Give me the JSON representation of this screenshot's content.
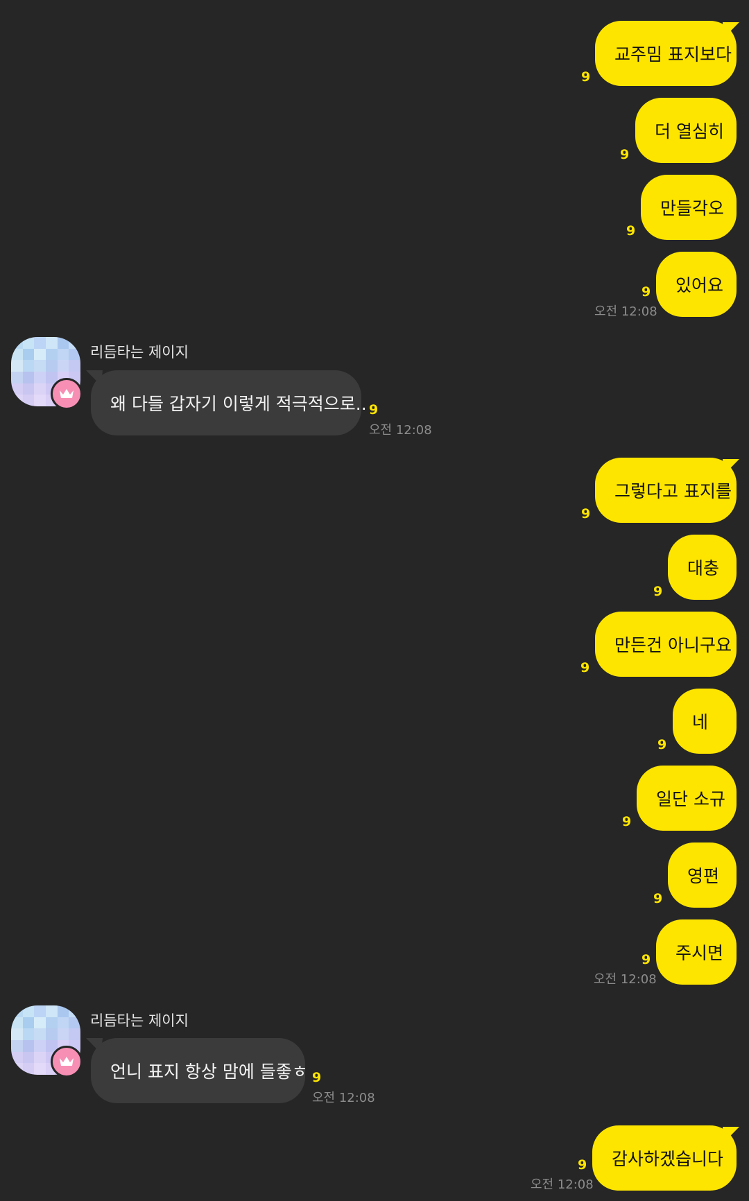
{
  "contact": {
    "name": "리듬타는 제이지"
  },
  "messages": [
    {
      "from": "me",
      "text": "교주밈 표지보다",
      "unread": "9"
    },
    {
      "from": "me",
      "text": "더 열심히",
      "unread": "9"
    },
    {
      "from": "me",
      "text": "만들각오",
      "unread": "9"
    },
    {
      "from": "me",
      "text": "있어요",
      "unread": "9",
      "time": "오전 12:08"
    },
    {
      "from": "other",
      "sender": "리듬타는 제이지",
      "text": "왜 다들 갑자기 이렇게 적극적으로..",
      "unread": "9",
      "time": "오전 12:08"
    },
    {
      "from": "me",
      "text": "그렇다고 표지를",
      "unread": "9"
    },
    {
      "from": "me",
      "text": "대충",
      "unread": "9"
    },
    {
      "from": "me",
      "text": "만든건 아니구요",
      "unread": "9"
    },
    {
      "from": "me",
      "text": "네",
      "unread": "9"
    },
    {
      "from": "me",
      "text": "일단 소규",
      "unread": "9"
    },
    {
      "from": "me",
      "text": "영편",
      "unread": "9"
    },
    {
      "from": "me",
      "text": "주시면",
      "unread": "9",
      "time": "오전 12:08"
    },
    {
      "from": "other",
      "sender": "리듬타는 제이지",
      "text": "언니 표지 항상 맘에 들좋ㅎ",
      "unread": "9",
      "time": "오전 12:08"
    },
    {
      "from": "me",
      "text": "감사하겠습니다",
      "unread": "9",
      "time": "오전 12:08"
    }
  ],
  "colors": {
    "background": "#262626",
    "my_bubble": "#FEE500",
    "other_bubble": "#3b3b3b",
    "unread": "#FEE500",
    "badge": "#f78fb5"
  },
  "icons": {
    "avatar_badge": "crown-icon"
  }
}
